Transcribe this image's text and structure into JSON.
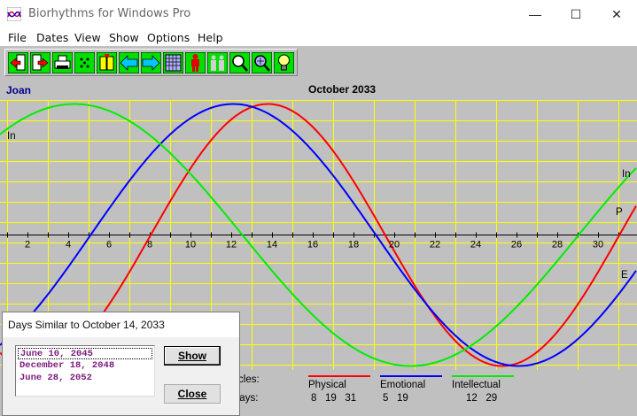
{
  "window": {
    "title": "Biorhythms for Windows Pro",
    "minimize_glyph": "—",
    "maximize_glyph": "☐",
    "close_glyph": "✕"
  },
  "menu": [
    {
      "label": "File"
    },
    {
      "label": "Dates"
    },
    {
      "label": "View"
    },
    {
      "label": "Show"
    },
    {
      "label": "Options"
    },
    {
      "label": "Help"
    }
  ],
  "toolbar": {
    "buttons": [
      {
        "icon": "open-file-icon"
      },
      {
        "icon": "exit-icon"
      },
      {
        "icon": "print-icon"
      },
      {
        "icon": "dice-icon"
      },
      {
        "icon": "compatibility-icon"
      },
      {
        "icon": "arrow-left-icon"
      },
      {
        "icon": "arrow-right-icon"
      },
      {
        "icon": "calendar-grid-icon"
      },
      {
        "icon": "person-icon"
      },
      {
        "icon": "people-icon"
      },
      {
        "icon": "zoom-search-icon"
      },
      {
        "icon": "find-dates-icon"
      },
      {
        "icon": "lightbulb-icon"
      }
    ]
  },
  "colors": {
    "physical": "#ff0000",
    "emotional": "#0000ff",
    "intellectual": "#00ee00",
    "grid": "#ffff00",
    "chart_bg": "#c0c0c0",
    "name": "#00008b",
    "list_text": "#7a1a7a"
  },
  "chart": {
    "person_name": "Joan",
    "month_title": "October 2033",
    "curve_labels": {
      "intellectual_left": "In",
      "intellectual_right": "In",
      "physical_right": "P",
      "emotional_right": "E"
    }
  },
  "chart_data": {
    "type": "line",
    "title": "October 2033",
    "x_ticks": [
      2,
      4,
      6,
      8,
      10,
      12,
      14,
      16,
      18,
      20,
      22,
      24,
      26,
      28,
      30
    ],
    "xlim": [
      0.5,
      31.8
    ],
    "ylim": [
      -1,
      1
    ],
    "grid": true,
    "series": [
      {
        "name": "Physical",
        "period": 23,
        "peak_day": 13.8
      },
      {
        "name": "Emotional",
        "period": 28,
        "peak_day": 12.1
      },
      {
        "name": "Intellectual",
        "period": 33,
        "peak_day": 4.3
      }
    ]
  },
  "legend": {
    "cycles_label": "Cycles:",
    "days_label": "Days:",
    "items": [
      {
        "name": "Physical",
        "days": "8   19   31"
      },
      {
        "name": "Emotional",
        "days": "5   19"
      },
      {
        "name": "Intellectual",
        "days": "12   29"
      }
    ]
  },
  "dialog": {
    "title": "Days Similar to October 14, 2033",
    "dates": [
      "June  10, 2045",
      "December  18, 2048",
      "June  28, 2052"
    ],
    "show_button": "Show",
    "close_button": "Close"
  }
}
